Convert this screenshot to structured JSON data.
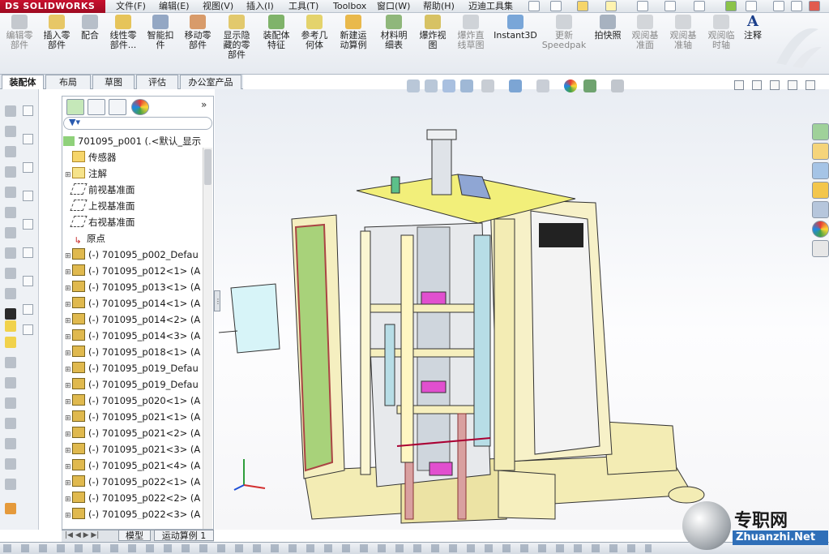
{
  "app": {
    "logo": "DS SOLIDWORKS"
  },
  "menu": [
    "文件(F)",
    "编辑(E)",
    "视图(V)",
    "插入(I)",
    "工具(T)",
    "Toolbox",
    "窗口(W)",
    "帮助(H)",
    "迈迪工具集"
  ],
  "commands": [
    {
      "label": "编辑零\n部件",
      "icon": "edit-component-icon",
      "enabled": false
    },
    {
      "label": "插入零\n部件",
      "icon": "insert-component-icon",
      "enabled": true
    },
    {
      "label": "配合",
      "icon": "mate-icon",
      "enabled": true
    },
    {
      "label": "线性零\n部件...",
      "icon": "linear-pattern-icon",
      "enabled": true
    },
    {
      "label": "智能扣\n件",
      "icon": "smart-fastener-icon",
      "enabled": true
    },
    {
      "label": "移动零\n部件",
      "icon": "move-component-icon",
      "enabled": true
    },
    {
      "label": "显示隐\n藏的零\n部件",
      "icon": "show-hidden-icon",
      "enabled": true
    },
    {
      "label": "装配体\n特征",
      "icon": "assembly-feature-icon",
      "enabled": true
    },
    {
      "label": "参考几\n何体",
      "icon": "reference-geometry-icon",
      "enabled": true
    },
    {
      "label": "新建运\n动算例",
      "icon": "motion-study-icon",
      "enabled": true
    },
    {
      "label": "材料明\n细表",
      "icon": "bom-icon",
      "enabled": true
    },
    {
      "label": "爆炸视\n图",
      "icon": "exploded-view-icon",
      "enabled": true
    },
    {
      "label": "爆炸直\n线草图",
      "icon": "explode-line-sketch-icon",
      "enabled": false
    },
    {
      "label": "Instant3D",
      "icon": "instant3d-icon",
      "enabled": true
    },
    {
      "label": "更新\nSpeedpak",
      "icon": "speedpak-icon",
      "enabled": false
    },
    {
      "label": "拍快照",
      "icon": "snapshot-icon",
      "enabled": true
    },
    {
      "label": "观阅基\n准面",
      "icon": "view-planes-icon",
      "enabled": false
    },
    {
      "label": "观阅基\n准轴",
      "icon": "view-axes-icon",
      "enabled": false
    },
    {
      "label": "观阅临\n时轴",
      "icon": "view-temp-axes-icon",
      "enabled": false
    },
    {
      "label": "注释",
      "icon": "annotation-icon",
      "enabled": true
    }
  ],
  "tabs": [
    "装配体",
    "布局",
    "草图",
    "评估",
    "办公室产品"
  ],
  "active_tab": "装配体",
  "tree": {
    "root": "701095_p001  (.<默认_显示",
    "items": [
      {
        "label": "传感器",
        "icon": "sensor-icon",
        "expandable": false
      },
      {
        "label": "注解",
        "icon": "annotation-folder-icon",
        "expandable": true
      },
      {
        "label": "前视基准面",
        "icon": "plane-icon",
        "expandable": false
      },
      {
        "label": "上视基准面",
        "icon": "plane-icon",
        "expandable": false
      },
      {
        "label": "右视基准面",
        "icon": "plane-icon",
        "expandable": false
      },
      {
        "label": "原点",
        "icon": "origin-icon",
        "expandable": false
      },
      {
        "label": "(-) 701095_p002_Defau",
        "icon": "part-icon",
        "expandable": true
      },
      {
        "label": "(-) 701095_p012<1> (A",
        "icon": "part-icon",
        "expandable": true
      },
      {
        "label": "(-) 701095_p013<1> (A",
        "icon": "part-icon",
        "expandable": true
      },
      {
        "label": "(-) 701095_p014<1> (A",
        "icon": "part-icon",
        "expandable": true
      },
      {
        "label": "(-) 701095_p014<2> (A",
        "icon": "part-icon",
        "expandable": true
      },
      {
        "label": "(-) 701095_p014<3> (A",
        "icon": "part-icon",
        "expandable": true
      },
      {
        "label": "(-) 701095_p018<1> (A",
        "icon": "part-icon",
        "expandable": true
      },
      {
        "label": "(-) 701095_p019_Defau",
        "icon": "part-icon",
        "expandable": true
      },
      {
        "label": "(-) 701095_p019_Defau",
        "icon": "part-icon",
        "expandable": true
      },
      {
        "label": "(-) 701095_p020<1> (A",
        "icon": "part-icon",
        "expandable": true
      },
      {
        "label": "(-) 701095_p021<1> (A",
        "icon": "part-icon",
        "expandable": true
      },
      {
        "label": "(-) 701095_p021<2> (A",
        "icon": "part-icon",
        "expandable": true
      },
      {
        "label": "(-) 701095_p021<3> (A",
        "icon": "part-icon",
        "expandable": true
      },
      {
        "label": "(-) 701095_p021<4> (A",
        "icon": "part-icon",
        "expandable": true
      },
      {
        "label": "(-) 701095_p022<1> (A",
        "icon": "part-icon",
        "expandable": true
      },
      {
        "label": "(-) 701095_p022<2> (A",
        "icon": "part-icon",
        "expandable": true
      },
      {
        "label": "(-) 701095_p022<3> (A",
        "icon": "part-icon",
        "expandable": true
      }
    ]
  },
  "bottom_tabs": [
    "模型",
    "运动算例 1"
  ],
  "watermark": {
    "cn": "专职网",
    "url": "Zhuanzhi.Net"
  },
  "colors": {
    "accent_red": "#c8102e",
    "model_yellow": "#f2ef7a",
    "frame_cream": "#f3ecb4"
  }
}
